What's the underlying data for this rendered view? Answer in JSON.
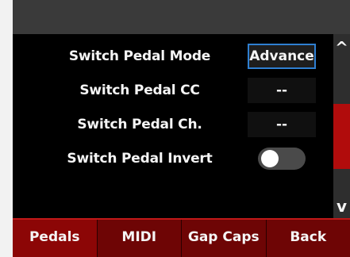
{
  "settings": {
    "rows": [
      {
        "label": "Switch Pedal Mode",
        "value": "Advance"
      },
      {
        "label": "Switch Pedal CC",
        "value": "--"
      },
      {
        "label": "Switch Pedal Ch.",
        "value": "--"
      },
      {
        "label": "Switch Pedal Invert",
        "toggle_state": "off"
      }
    ]
  },
  "scrollbar": {
    "up_icon": "chevron-up-icon",
    "up_glyph": "^",
    "down_icon": "chevron-down-icon",
    "down_glyph": "v"
  },
  "nav": {
    "tabs": [
      {
        "label": "Pedals",
        "active": true
      },
      {
        "label": "MIDI",
        "active": false
      },
      {
        "label": "Gap Caps",
        "active": false
      },
      {
        "label": "Back",
        "active": false
      }
    ]
  },
  "colors": {
    "nav_background": "#6e0505",
    "nav_active": "#8c0606",
    "scroll_thumb": "#b10c0c",
    "selected_border": "#2f7fd1",
    "content_background": "#000000"
  }
}
